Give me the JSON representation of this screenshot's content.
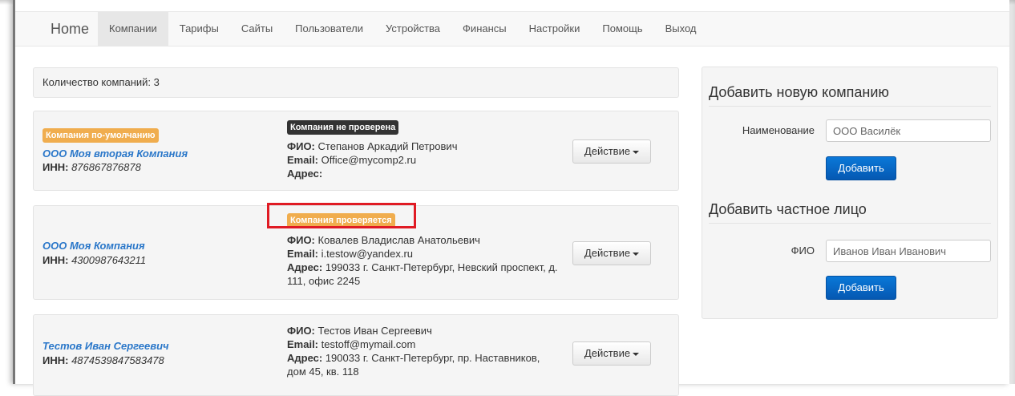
{
  "navbar": {
    "brand": "Home",
    "items": [
      "Компании",
      "Тарифы",
      "Сайты",
      "Пользователи",
      "Устройства",
      "Финансы",
      "Настройки",
      "Помощь",
      "Выход"
    ]
  },
  "count": "Количество компаний: 3",
  "labels": {
    "fio": "ФИО:",
    "email": "Email:",
    "address": "Адрес:",
    "inn": "ИНН:"
  },
  "companies": [
    {
      "default_badge": "Компания по-умолчанию",
      "name": "ООО Моя вторая Компания",
      "inn": "876867876878",
      "status_badge": "Компания не проверена",
      "fio": "Степанов Аркадий Петрович",
      "email": "Office@mycomp2.ru",
      "address": "",
      "action": "Действие"
    },
    {
      "name": "ООО Моя Компания",
      "inn": "4300987643211",
      "status_badge": "Компания проверяется",
      "fio": "Ковалев Владислав Анатольевич",
      "email": "i.testow@yandex.ru",
      "address": "199033 г. Санкт-Петербург, Невский проспект, д. 111, офис 2245",
      "action": "Действие"
    },
    {
      "name": "Тестов Иван Сергеевич",
      "inn": "4874539847583478",
      "fio": "Тестов Иван Сергеевич",
      "email": "testoff@mymail.com",
      "address": "190033 г. Санкт-Петербург, пр. Наставников, дом 45, кв. 118",
      "action": "Действие"
    }
  ],
  "add_company": {
    "title": "Добавить новую компанию",
    "field_label": "Наименование",
    "placeholder": "ООО Василёк",
    "button": "Добавить"
  },
  "add_person": {
    "title": "Добавить частное лицо",
    "field_label": "ФИО",
    "placeholder": "Иванов Иван Иванович",
    "button": "Добавить"
  },
  "colors": {
    "link": "#2a77c9",
    "badge_orange": "#f0ad4e",
    "badge_dark": "#333333",
    "primary": "#0a6fcc",
    "highlight": "#e01b24"
  }
}
